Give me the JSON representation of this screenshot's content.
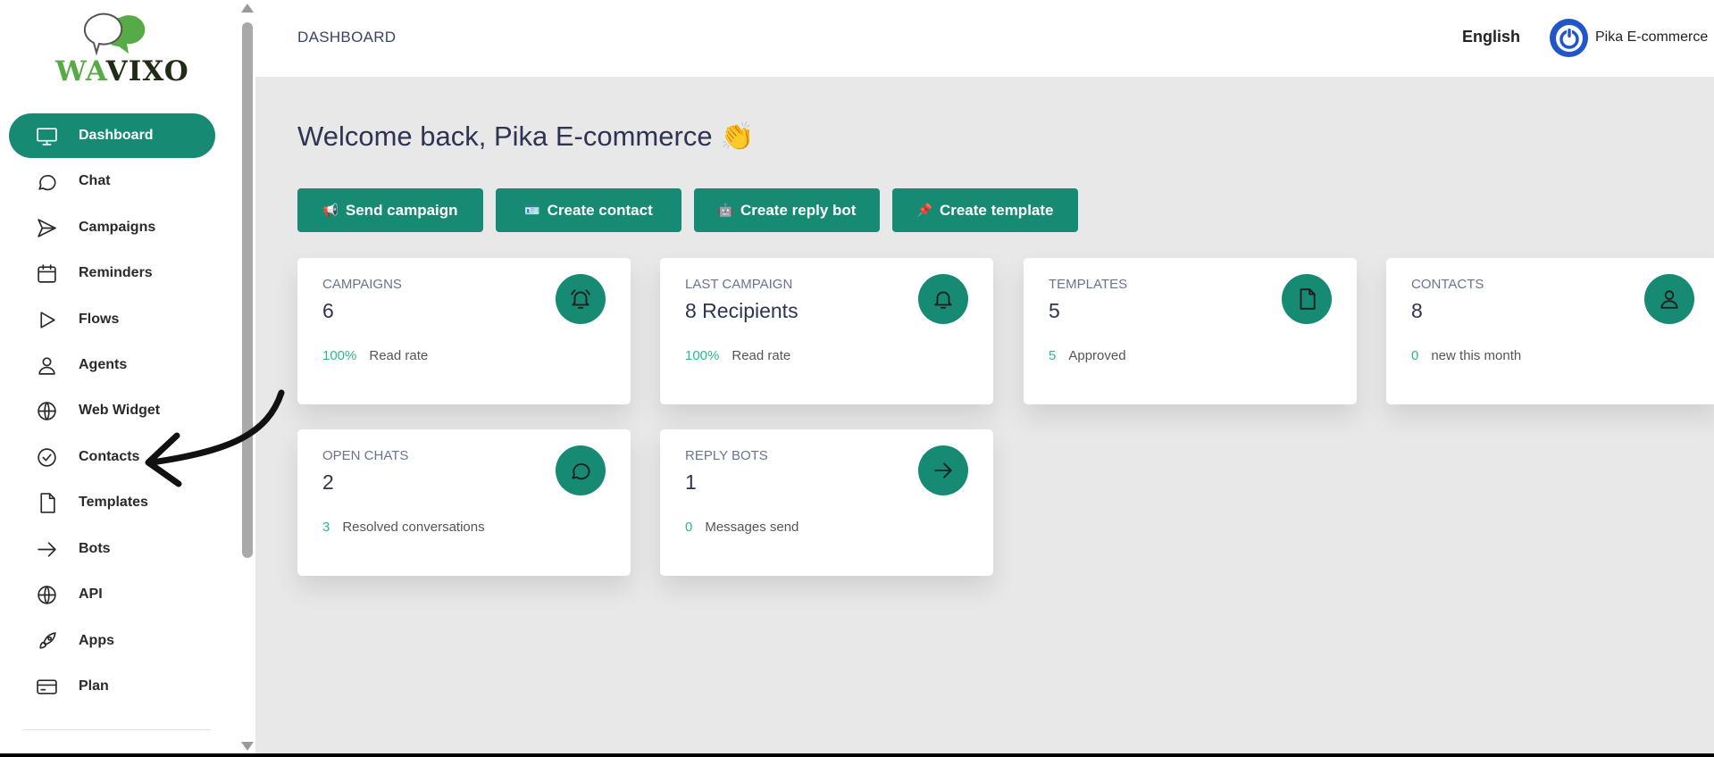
{
  "brand": {
    "logo_part1": "WA",
    "logo_part2": "VIXO"
  },
  "sidebar": {
    "items": [
      {
        "label": "Dashboard",
        "icon": "monitor-icon",
        "active": true
      },
      {
        "label": "Chat",
        "icon": "chat-bubble-icon"
      },
      {
        "label": "Campaigns",
        "icon": "send-icon"
      },
      {
        "label": "Reminders",
        "icon": "calendar-icon"
      },
      {
        "label": "Flows",
        "icon": "play-icon"
      },
      {
        "label": "Agents",
        "icon": "user-icon"
      },
      {
        "label": "Web Widget",
        "icon": "globe-icon"
      },
      {
        "label": "Contacts",
        "icon": "check-circle-icon"
      },
      {
        "label": "Templates",
        "icon": "file-icon"
      },
      {
        "label": "Bots",
        "icon": "arrow-right-icon"
      },
      {
        "label": "API",
        "icon": "globe-icon"
      },
      {
        "label": "Apps",
        "icon": "rocket-icon"
      },
      {
        "label": "Plan",
        "icon": "credit-card-icon"
      }
    ]
  },
  "header": {
    "title": "DASHBOARD",
    "language": "English",
    "user_name": "Pika E-commerce"
  },
  "main": {
    "welcome": "Welcome back, Pika E-commerce 👏",
    "actions": [
      {
        "emoji": "📢",
        "label": "Send campaign"
      },
      {
        "emoji": "🪪",
        "label": "Create contact"
      },
      {
        "emoji": "🤖",
        "label": "Create reply bot"
      },
      {
        "emoji": "📌",
        "label": "Create template"
      }
    ],
    "cards": [
      {
        "label": "CAMPAIGNS",
        "value": "6",
        "foot_num": "100%",
        "foot_text": "Read rate",
        "icon": "bell-ring-icon"
      },
      {
        "label": "LAST CAMPAIGN",
        "value": "8 Recipients",
        "foot_num": "100%",
        "foot_text": "Read rate",
        "icon": "bell-icon"
      },
      {
        "label": "TEMPLATES",
        "value": "5",
        "foot_num": "5",
        "foot_text": "Approved",
        "icon": "file-icon"
      },
      {
        "label": "CONTACTS",
        "value": "8",
        "foot_num": "0",
        "foot_text": "new this month",
        "icon": "user-icon"
      },
      {
        "label": "OPEN CHATS",
        "value": "2",
        "foot_num": "3",
        "foot_text": "Resolved conversations",
        "icon": "chat-bubble-icon"
      },
      {
        "label": "REPLY BOTS",
        "value": "1",
        "foot_num": "0",
        "foot_text": "Messages send",
        "icon": "arrow-right-icon"
      }
    ]
  },
  "colors": {
    "accent": "#178a74",
    "positive": "#2db791",
    "avatar": "#2156c9",
    "background": "#e8e8e9"
  }
}
